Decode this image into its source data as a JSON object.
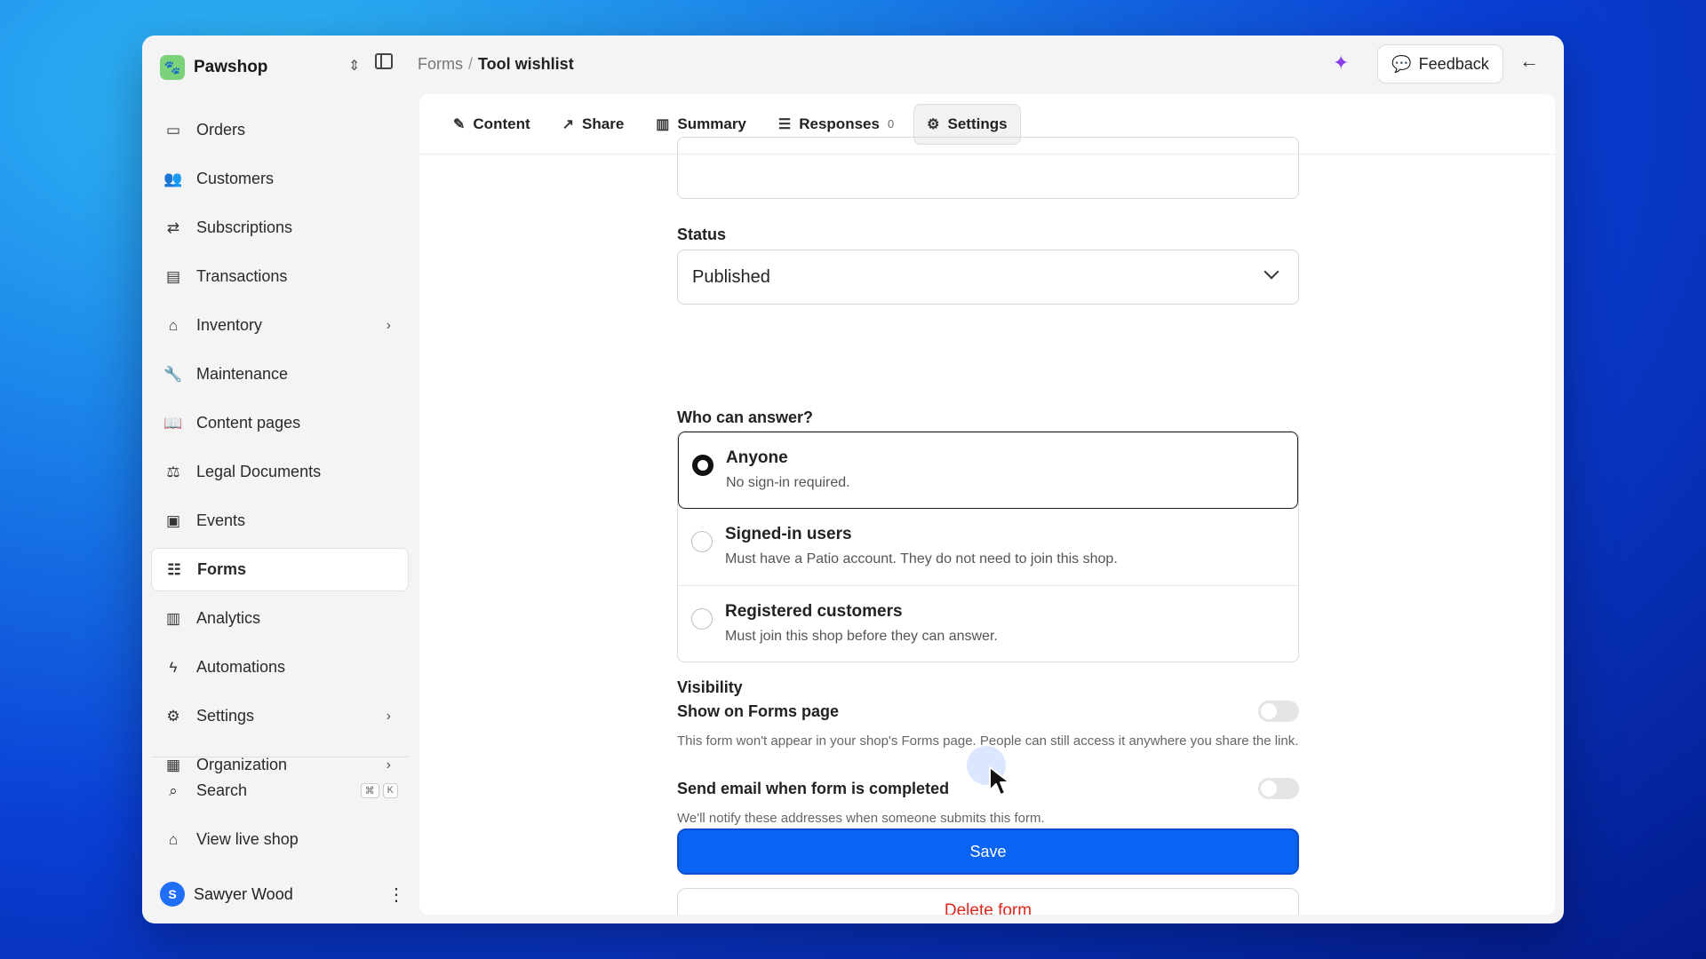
{
  "workspace": {
    "name": "Pawshop",
    "logo_icon": "paw-logo-icon"
  },
  "breadcrumb": {
    "parent": "Forms",
    "separator": "/",
    "current": "Tool wishlist"
  },
  "topbar": {
    "feedback_label": "Feedback"
  },
  "sidebar": {
    "items": [
      {
        "label": "Orders",
        "icon": "inbox-icon"
      },
      {
        "label": "Customers",
        "icon": "users-icon"
      },
      {
        "label": "Subscriptions",
        "icon": "repeat-icon"
      },
      {
        "label": "Transactions",
        "icon": "card-icon"
      },
      {
        "label": "Inventory",
        "icon": "tag-icon",
        "has_arrow": true
      },
      {
        "label": "Maintenance",
        "icon": "wrench-icon"
      },
      {
        "label": "Content pages",
        "icon": "book-icon"
      },
      {
        "label": "Legal Documents",
        "icon": "scale-icon"
      },
      {
        "label": "Events",
        "icon": "ticket-icon"
      },
      {
        "label": "Forms",
        "icon": "form-icon",
        "active": true
      },
      {
        "label": "Analytics",
        "icon": "bar-chart-icon"
      },
      {
        "label": "Automations",
        "icon": "bolt-icon"
      },
      {
        "label": "Settings",
        "icon": "gear-icon",
        "has_arrow": true
      },
      {
        "label": "Organization",
        "icon": "building-icon",
        "has_arrow": true
      }
    ],
    "search": {
      "label": "Search",
      "shortcut": [
        "⌘",
        "K"
      ]
    },
    "view_shop": {
      "label": "View live shop"
    },
    "user": {
      "initial": "S",
      "name": "Sawyer Wood"
    }
  },
  "tabs": [
    {
      "label": "Content",
      "icon": "pencil-icon"
    },
    {
      "label": "Share",
      "icon": "share-icon"
    },
    {
      "label": "Summary",
      "icon": "bar-chart-icon"
    },
    {
      "label": "Responses",
      "icon": "list-icon",
      "badge": "0"
    },
    {
      "label": "Settings",
      "icon": "gear-icon",
      "active": true
    }
  ],
  "form": {
    "status_label": "Status",
    "status_value": "Published",
    "who_label": "Who can answer?",
    "options": [
      {
        "title": "Anyone",
        "desc": "No sign-in required.",
        "selected": true
      },
      {
        "title": "Signed-in users",
        "desc": "Must have a Patio account. They do not need to join this shop.",
        "selected": false
      },
      {
        "title": "Registered customers",
        "desc": "Must join this shop before they can answer.",
        "selected": false
      }
    ],
    "visibility_label": "Visibility",
    "show_on_forms": {
      "title": "Show on Forms page",
      "desc": "This form won't appear in your shop's Forms page. People can still access it anywhere you share the link.",
      "enabled": false
    },
    "send_email": {
      "title": "Send email when form is completed",
      "desc": "We'll notify these addresses when someone submits this form.",
      "enabled": false
    },
    "save_label": "Save",
    "delete_label": "Delete form"
  },
  "colors": {
    "accent": "#0a63f2",
    "danger": "#e0261b",
    "spark": "#8b3fe8"
  }
}
